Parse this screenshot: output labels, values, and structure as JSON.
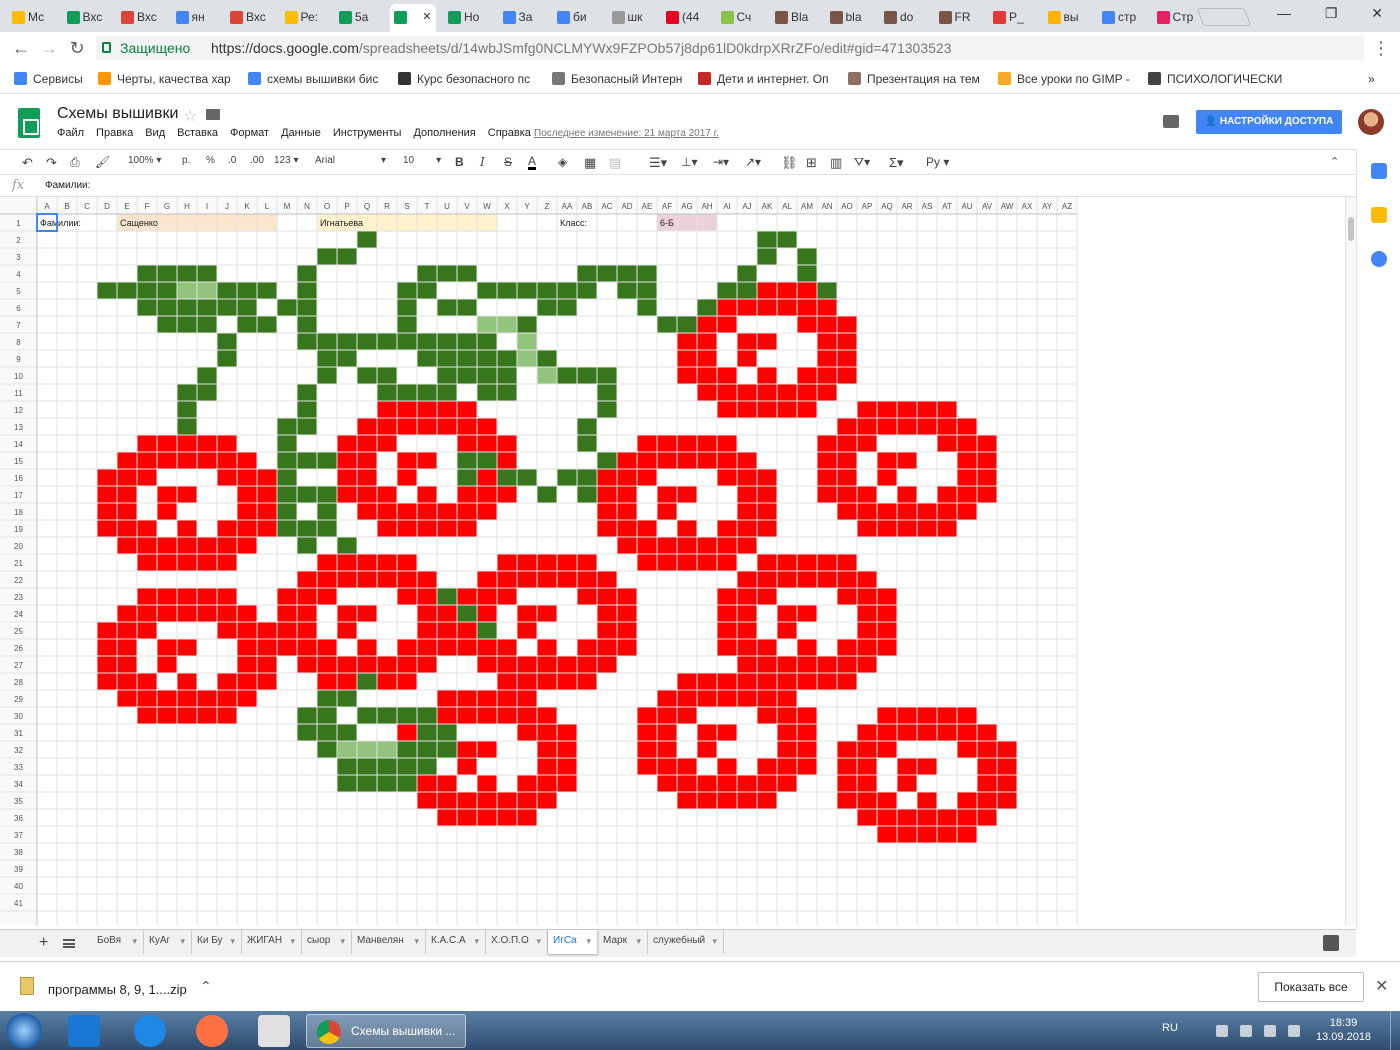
{
  "browser": {
    "tabs": [
      {
        "label": "Мс",
        "color": "#fbbc04"
      },
      {
        "label": "Вхс",
        "color": "#0f9d58"
      },
      {
        "label": "Вхс",
        "color": "#db4437"
      },
      {
        "label": "ян",
        "color": "#4285f4"
      },
      {
        "label": "Вхс",
        "color": "#db4437"
      },
      {
        "label": "Ре:",
        "color": "#fbbc04"
      },
      {
        "label": "5а",
        "color": "#0f9d58"
      },
      {
        "label": "",
        "color": "#0f9d58",
        "active": true
      },
      {
        "label": "Но",
        "color": "#0f9d58"
      },
      {
        "label": "За",
        "color": "#4285f4"
      },
      {
        "label": "би",
        "color": "#4285f4"
      },
      {
        "label": "шк",
        "color": "#999999"
      },
      {
        "label": "(44",
        "color": "#e60023"
      },
      {
        "label": "Сч",
        "color": "#8bc34a"
      },
      {
        "label": "Bla",
        "color": "#795548"
      },
      {
        "label": "bla",
        "color": "#795548"
      },
      {
        "label": "do",
        "color": "#795548"
      },
      {
        "label": "FR",
        "color": "#795548"
      },
      {
        "label": "P_",
        "color": "#e53935"
      },
      {
        "label": "вы",
        "color": "#ffb300"
      },
      {
        "label": "стр",
        "color": "#4285f4"
      },
      {
        "label": "Стр",
        "color": "#e91e63"
      }
    ],
    "secure_label": "Защищено",
    "url_host": "https://docs.google.com",
    "url_path": "/spreadsheets/d/14wbJSmfg0NCLMYWx9FZPOb57j8dp61lD0kdrpXRrZFo/edit#gid=471303523",
    "bookmarks": [
      {
        "label": "Сервисы",
        "color": "#4285f4"
      },
      {
        "label": "Черты, качества хар",
        "color": "#ff9800"
      },
      {
        "label": "схемы вышивки бис",
        "color": "#4285f4"
      },
      {
        "label": "Курс безопасного пс",
        "color": "#333333"
      },
      {
        "label": "Безопасный Интерн",
        "color": "#777777"
      },
      {
        "label": "Дети и интернет. Оп",
        "color": "#c62828"
      },
      {
        "label": "Презентация на тем",
        "color": "#8d6e63"
      },
      {
        "label": "Все уроки по GIMP -",
        "color": "#f9a825"
      },
      {
        "label": "ПСИХОЛОГИЧЕСКИ",
        "color": "#424242"
      }
    ]
  },
  "doc": {
    "title": "Схемы вышивки",
    "menus": [
      "Файл",
      "Правка",
      "Вид",
      "Вставка",
      "Формат",
      "Данные",
      "Инструменты",
      "Дополнения",
      "Справка"
    ],
    "last_edit": "Последнее изменение: 21 марта 2017 г.",
    "share_label": "НАСТРОЙКИ ДОСТУПА"
  },
  "toolbar": {
    "zoom": "100%",
    "currency": "р.",
    "percent": "%",
    "dec_less": ".0",
    "dec_more": ".00",
    "format_more": "123",
    "font": "Arial",
    "size": "10",
    "input_tool": "Ру"
  },
  "formula": {
    "fx": "fx",
    "value": "Фамилии:"
  },
  "grid": {
    "columns": [
      "A",
      "B",
      "C",
      "D",
      "E",
      "F",
      "G",
      "H",
      "I",
      "J",
      "K",
      "L",
      "M",
      "N",
      "O",
      "P",
      "Q",
      "R",
      "S",
      "T",
      "U",
      "V",
      "W",
      "X",
      "Y",
      "Z",
      "AA",
      "AB",
      "AC",
      "AD",
      "AE",
      "AF",
      "AG",
      "AH",
      "AI",
      "AJ",
      "AK",
      "AL",
      "AM",
      "AN",
      "AO",
      "AP",
      "AQ",
      "AR",
      "AS",
      "AT",
      "AU",
      "AV",
      "AW",
      "AX",
      "AY",
      "AZ"
    ],
    "row_count": 41,
    "row1": [
      {
        "col": 0,
        "text": "Фамилии:"
      },
      {
        "col": 4,
        "text": "Сащенко",
        "span": 8,
        "fill": "#fce5cd"
      },
      {
        "col": 14,
        "text": "Игнатьева",
        "span": 9,
        "fill": "#fff2cc"
      },
      {
        "col": 26,
        "text": "Класс:"
      },
      {
        "col": 31,
        "text": "6-Б",
        "span": 3,
        "fill": "#ead1dc"
      }
    ],
    "colors": {
      "red": "#ff0000",
      "dark_green": "#38761d",
      "light_green": "#93c47d"
    },
    "flowers": [
      {
        "c": 3,
        "r": 14
      },
      {
        "c": 3,
        "r": 23
      },
      {
        "c": 12,
        "r": 21
      },
      {
        "c": 15,
        "r": 12
      },
      {
        "c": 18,
        "r": 29
      },
      {
        "c": 21,
        "r": 21
      },
      {
        "c": 28,
        "r": 14
      },
      {
        "c": 30,
        "r": 28
      },
      {
        "c": 32,
        "r": 5
      },
      {
        "c": 34,
        "r": 21
      },
      {
        "c": 39,
        "r": 12
      },
      {
        "c": 40,
        "r": 30
      }
    ],
    "green_path": [
      [
        3,
        5
      ],
      [
        4,
        5
      ],
      [
        5,
        4
      ],
      [
        6,
        4
      ],
      [
        7,
        4
      ],
      [
        8,
        4
      ],
      [
        5,
        5
      ],
      [
        6,
        5
      ],
      [
        7,
        5
      ],
      [
        8,
        5
      ],
      [
        9,
        5
      ],
      [
        5,
        6
      ],
      [
        6,
        6
      ],
      [
        7,
        6
      ],
      [
        8,
        6
      ],
      [
        9,
        6
      ],
      [
        10,
        6
      ],
      [
        6,
        7
      ],
      [
        7,
        7
      ],
      [
        8,
        7
      ],
      [
        10,
        5
      ],
      [
        11,
        5
      ],
      [
        12,
        6
      ],
      [
        13,
        6
      ],
      [
        11,
        7
      ],
      [
        10,
        7
      ],
      [
        9,
        8
      ],
      [
        9,
        9
      ],
      [
        8,
        10
      ],
      [
        8,
        11
      ],
      [
        7,
        11
      ],
      [
        7,
        12
      ],
      [
        7,
        13
      ],
      [
        13,
        5
      ],
      [
        13,
        4
      ],
      [
        14,
        3
      ],
      [
        15,
        3
      ],
      [
        16,
        2
      ],
      [
        13,
        7
      ],
      [
        13,
        8
      ],
      [
        14,
        8
      ],
      [
        15,
        8
      ],
      [
        16,
        8
      ],
      [
        17,
        8
      ],
      [
        14,
        9
      ],
      [
        15,
        9
      ],
      [
        14,
        10
      ],
      [
        16,
        10
      ],
      [
        17,
        10
      ],
      [
        17,
        11
      ],
      [
        18,
        11
      ],
      [
        19,
        11
      ],
      [
        20,
        11
      ],
      [
        13,
        11
      ],
      [
        13,
        12
      ],
      [
        13,
        13
      ],
      [
        12,
        13
      ],
      [
        12,
        14
      ],
      [
        12,
        15
      ],
      [
        12,
        16
      ],
      [
        12,
        17
      ],
      [
        12,
        18
      ],
      [
        12,
        19
      ],
      [
        13,
        15
      ],
      [
        14,
        15
      ],
      [
        13,
        17
      ],
      [
        14,
        17
      ],
      [
        13,
        19
      ],
      [
        15,
        20
      ],
      [
        14,
        18
      ],
      [
        14,
        19
      ],
      [
        13,
        20
      ],
      [
        19,
        4
      ],
      [
        20,
        4
      ],
      [
        21,
        4
      ],
      [
        18,
        5
      ],
      [
        19,
        5
      ],
      [
        22,
        5
      ],
      [
        23,
        5
      ],
      [
        24,
        5
      ],
      [
        25,
        5
      ],
      [
        18,
        6
      ],
      [
        18,
        7
      ],
      [
        20,
        6
      ],
      [
        21,
        6
      ],
      [
        18,
        8
      ],
      [
        19,
        8
      ],
      [
        20,
        8
      ],
      [
        21,
        8
      ],
      [
        22,
        8
      ],
      [
        19,
        9
      ],
      [
        20,
        9
      ],
      [
        21,
        9
      ],
      [
        22,
        9
      ],
      [
        23,
        9
      ],
      [
        20,
        10
      ],
      [
        21,
        10
      ],
      [
        22,
        10
      ],
      [
        23,
        10
      ],
      [
        22,
        11
      ],
      [
        23,
        11
      ],
      [
        26,
        5
      ],
      [
        27,
        5
      ],
      [
        27,
        4
      ],
      [
        28,
        4
      ],
      [
        29,
        4
      ],
      [
        30,
        4
      ],
      [
        26,
        6
      ],
      [
        25,
        6
      ],
      [
        24,
        7
      ],
      [
        24,
        8
      ],
      [
        25,
        9
      ],
      [
        25,
        10
      ],
      [
        26,
        10
      ],
      [
        27,
        10
      ],
      [
        28,
        10
      ],
      [
        28,
        11
      ],
      [
        28,
        12
      ],
      [
        27,
        13
      ],
      [
        27,
        14
      ],
      [
        28,
        15
      ],
      [
        26,
        16
      ],
      [
        27,
        16
      ],
      [
        25,
        17
      ],
      [
        27,
        17
      ],
      [
        24,
        16
      ],
      [
        23,
        16
      ],
      [
        22,
        15
      ],
      [
        21,
        15
      ],
      [
        21,
        16
      ],
      [
        29,
        5
      ],
      [
        30,
        5
      ],
      [
        30,
        6
      ],
      [
        31,
        7
      ],
      [
        32,
        7
      ],
      [
        33,
        6
      ],
      [
        34,
        5
      ],
      [
        35,
        5
      ],
      [
        35,
        4
      ],
      [
        36,
        3
      ],
      [
        36,
        2
      ],
      [
        37,
        2
      ],
      [
        38,
        3
      ],
      [
        38,
        4
      ],
      [
        39,
        5
      ],
      [
        20,
        23
      ],
      [
        21,
        24
      ],
      [
        22,
        25
      ],
      [
        16,
        28
      ],
      [
        14,
        29
      ],
      [
        15,
        29
      ],
      [
        13,
        30
      ],
      [
        13,
        31
      ],
      [
        14,
        31
      ],
      [
        15,
        31
      ],
      [
        16,
        30
      ],
      [
        17,
        30
      ],
      [
        18,
        30
      ],
      [
        15,
        32
      ],
      [
        16,
        32
      ],
      [
        17,
        32
      ],
      [
        18,
        32
      ],
      [
        19,
        32
      ],
      [
        14,
        32
      ],
      [
        15,
        33
      ],
      [
        16,
        33
      ],
      [
        17,
        33
      ],
      [
        18,
        33
      ],
      [
        19,
        33
      ],
      [
        15,
        34
      ],
      [
        16,
        34
      ],
      [
        17,
        34
      ],
      [
        18,
        34
      ],
      [
        16,
        30
      ],
      [
        19,
        31
      ],
      [
        20,
        31
      ],
      [
        20,
        32
      ],
      [
        14,
        30
      ],
      [
        19,
        30
      ]
    ],
    "light_path": [
      [
        7,
        5
      ],
      [
        8,
        5
      ],
      [
        22,
        7
      ],
      [
        23,
        7
      ],
      [
        24,
        8
      ],
      [
        24,
        9
      ],
      [
        25,
        10
      ],
      [
        15,
        32
      ],
      [
        16,
        32
      ],
      [
        17,
        32
      ]
    ]
  },
  "sheets": [
    "БоВя",
    "КуАг",
    "Ки Бу",
    "ЖИГАН",
    "сыор",
    "Манвелян",
    "К.А.С.А",
    "Х.О.П.О",
    "ИгСа",
    "Марк",
    "служебный"
  ],
  "active_sheet": "ИгСа",
  "downloads": {
    "file": "программы 8, 9, 1....zip",
    "show_all": "Показать все"
  },
  "taskbar": {
    "chrome_label": "Схемы вышивки ...",
    "lang": "RU",
    "time": "18:39",
    "date": "13.09.2018"
  }
}
